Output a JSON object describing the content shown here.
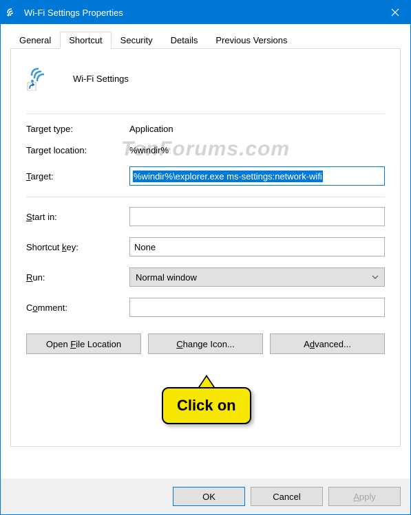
{
  "window": {
    "title": "Wi-Fi Settings Properties"
  },
  "tabs": {
    "general": "General",
    "shortcut": "Shortcut",
    "security": "Security",
    "details": "Details",
    "previous": "Previous Versions"
  },
  "shortcut": {
    "name": "Wi-Fi Settings",
    "target_type_label": "Target type:",
    "target_type_value": "Application",
    "target_location_label": "Target location:",
    "target_location_value": "%windir%",
    "target_label_pre": "T",
    "target_label_post": "arget:",
    "target_value": "%windir%\\explorer.exe ms-settings:network-wifi",
    "startin_label_pre": "S",
    "startin_label_post": "tart in:",
    "startin_value": "",
    "shortcutkey_label_pre": "Shortcut ",
    "shortcutkey_label_u": "k",
    "shortcutkey_label_post": "ey:",
    "shortcutkey_value": "None",
    "run_label_u": "R",
    "run_label_post": "un:",
    "run_value": "Normal window",
    "comment_label_pre": "C",
    "comment_label_u": "o",
    "comment_label_post": "mment:",
    "comment_value": "",
    "open_file_pre": "Open ",
    "open_file_u": "F",
    "open_file_post": "ile Location",
    "change_icon_u": "C",
    "change_icon_post": "hange Icon...",
    "advanced_pre": "A",
    "advanced_u": "d",
    "advanced_post": "vanced..."
  },
  "footer": {
    "ok": "OK",
    "cancel": "Cancel",
    "apply_u": "A",
    "apply_post": "pply"
  },
  "watermark": "TenForums.com",
  "callout": "Click on"
}
